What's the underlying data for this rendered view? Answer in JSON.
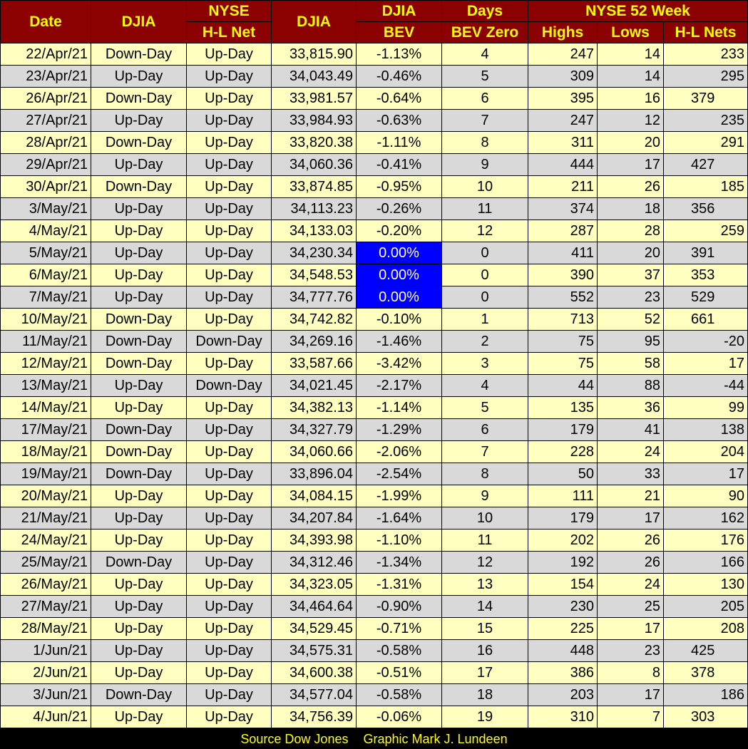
{
  "header": {
    "date": "Date",
    "djia_signal": "DJIA",
    "nyse_hl_line1": "NYSE",
    "nyse_hl_line2": "H-L Net",
    "djia_close": "DJIA",
    "bev_line1": "DJIA",
    "bev_line2": "BEV",
    "days_line1": "Days",
    "days_line2": "BEV Zero",
    "group_52week": "NYSE 52 Week",
    "highs": "Highs",
    "lows": "Lows",
    "hl_nets": "H-L Nets"
  },
  "rows": [
    {
      "date": "22/Apr/21",
      "djia": "Down-Day",
      "nyse": "Up-Day",
      "close": "33,815.90",
      "bev": "-1.13%",
      "days": "4",
      "highs": "247",
      "lows": "14",
      "net": "233",
      "net_align": "r"
    },
    {
      "date": "23/Apr/21",
      "djia": "Up-Day",
      "nyse": "Up-Day",
      "close": "34,043.49",
      "bev": "-0.46%",
      "days": "5",
      "highs": "309",
      "lows": "14",
      "net": "295",
      "net_align": "r"
    },
    {
      "date": "26/Apr/21",
      "djia": "Down-Day",
      "nyse": "Up-Day",
      "close": "33,981.57",
      "bev": "-0.64%",
      "days": "6",
      "highs": "395",
      "lows": "16",
      "net": "379",
      "net_align": "l"
    },
    {
      "date": "27/Apr/21",
      "djia": "Up-Day",
      "nyse": "Up-Day",
      "close": "33,984.93",
      "bev": "-0.63%",
      "days": "7",
      "highs": "247",
      "lows": "12",
      "net": "235",
      "net_align": "r"
    },
    {
      "date": "28/Apr/21",
      "djia": "Down-Day",
      "nyse": "Up-Day",
      "close": "33,820.38",
      "bev": "-1.11%",
      "days": "8",
      "highs": "311",
      "lows": "20",
      "net": "291",
      "net_align": "r"
    },
    {
      "date": "29/Apr/21",
      "djia": "Up-Day",
      "nyse": "Up-Day",
      "close": "34,060.36",
      "bev": "-0.41%",
      "days": "9",
      "highs": "444",
      "lows": "17",
      "net": "427",
      "net_align": "l"
    },
    {
      "date": "30/Apr/21",
      "djia": "Down-Day",
      "nyse": "Up-Day",
      "close": "33,874.85",
      "bev": "-0.95%",
      "days": "10",
      "highs": "211",
      "lows": "26",
      "net": "185",
      "net_align": "r"
    },
    {
      "date": "3/May/21",
      "djia": "Up-Day",
      "nyse": "Up-Day",
      "close": "34,113.23",
      "bev": "-0.26%",
      "days": "11",
      "highs": "374",
      "lows": "18",
      "net": "356",
      "net_align": "l"
    },
    {
      "date": "4/May/21",
      "djia": "Up-Day",
      "nyse": "Up-Day",
      "close": "34,133.03",
      "bev": "-0.20%",
      "days": "12",
      "highs": "287",
      "lows": "28",
      "net": "259",
      "net_align": "r"
    },
    {
      "date": "5/May/21",
      "djia": "Up-Day",
      "nyse": "Up-Day",
      "close": "34,230.34",
      "bev": "0.00%",
      "days": "0",
      "highs": "411",
      "lows": "20",
      "net": "391",
      "net_align": "l",
      "bev_zero": true
    },
    {
      "date": "6/May/21",
      "djia": "Up-Day",
      "nyse": "Up-Day",
      "close": "34,548.53",
      "bev": "0.00%",
      "days": "0",
      "highs": "390",
      "lows": "37",
      "net": "353",
      "net_align": "l",
      "bev_zero": true
    },
    {
      "date": "7/May/21",
      "djia": "Up-Day",
      "nyse": "Up-Day",
      "close": "34,777.76",
      "bev": "0.00%",
      "days": "0",
      "highs": "552",
      "lows": "23",
      "net": "529",
      "net_align": "l",
      "bev_zero": true
    },
    {
      "date": "10/May/21",
      "djia": "Down-Day",
      "nyse": "Up-Day",
      "close": "34,742.82",
      "bev": "-0.10%",
      "days": "1",
      "highs": "713",
      "lows": "52",
      "net": "661",
      "net_align": "l"
    },
    {
      "date": "11/May/21",
      "djia": "Down-Day",
      "nyse": "Down-Day",
      "close": "34,269.16",
      "bev": "-1.46%",
      "days": "2",
      "highs": "75",
      "lows": "95",
      "net": "-20",
      "net_align": "r"
    },
    {
      "date": "12/May/21",
      "djia": "Down-Day",
      "nyse": "Up-Day",
      "close": "33,587.66",
      "bev": "-3.42%",
      "days": "3",
      "highs": "75",
      "lows": "58",
      "net": "17",
      "net_align": "r"
    },
    {
      "date": "13/May/21",
      "djia": "Up-Day",
      "nyse": "Down-Day",
      "close": "34,021.45",
      "bev": "-2.17%",
      "days": "4",
      "highs": "44",
      "lows": "88",
      "net": "-44",
      "net_align": "r"
    },
    {
      "date": "14/May/21",
      "djia": "Up-Day",
      "nyse": "Up-Day",
      "close": "34,382.13",
      "bev": "-1.14%",
      "days": "5",
      "highs": "135",
      "lows": "36",
      "net": "99",
      "net_align": "r"
    },
    {
      "date": "17/May/21",
      "djia": "Down-Day",
      "nyse": "Up-Day",
      "close": "34,327.79",
      "bev": "-1.29%",
      "days": "6",
      "highs": "179",
      "lows": "41",
      "net": "138",
      "net_align": "r"
    },
    {
      "date": "18/May/21",
      "djia": "Down-Day",
      "nyse": "Up-Day",
      "close": "34,060.66",
      "bev": "-2.06%",
      "days": "7",
      "highs": "228",
      "lows": "24",
      "net": "204",
      "net_align": "r"
    },
    {
      "date": "19/May/21",
      "djia": "Down-Day",
      "nyse": "Up-Day",
      "close": "33,896.04",
      "bev": "-2.54%",
      "days": "8",
      "highs": "50",
      "lows": "33",
      "net": "17",
      "net_align": "r"
    },
    {
      "date": "20/May/21",
      "djia": "Up-Day",
      "nyse": "Up-Day",
      "close": "34,084.15",
      "bev": "-1.99%",
      "days": "9",
      "highs": "111",
      "lows": "21",
      "net": "90",
      "net_align": "r"
    },
    {
      "date": "21/May/21",
      "djia": "Up-Day",
      "nyse": "Up-Day",
      "close": "34,207.84",
      "bev": "-1.64%",
      "days": "10",
      "highs": "179",
      "lows": "17",
      "net": "162",
      "net_align": "r"
    },
    {
      "date": "24/May/21",
      "djia": "Up-Day",
      "nyse": "Up-Day",
      "close": "34,393.98",
      "bev": "-1.10%",
      "days": "11",
      "highs": "202",
      "lows": "26",
      "net": "176",
      "net_align": "r"
    },
    {
      "date": "25/May/21",
      "djia": "Down-Day",
      "nyse": "Up-Day",
      "close": "34,312.46",
      "bev": "-1.34%",
      "days": "12",
      "highs": "192",
      "lows": "26",
      "net": "166",
      "net_align": "r"
    },
    {
      "date": "26/May/21",
      "djia": "Up-Day",
      "nyse": "Up-Day",
      "close": "34,323.05",
      "bev": "-1.31%",
      "days": "13",
      "highs": "154",
      "lows": "24",
      "net": "130",
      "net_align": "r"
    },
    {
      "date": "27/May/21",
      "djia": "Up-Day",
      "nyse": "Up-Day",
      "close": "34,464.64",
      "bev": "-0.90%",
      "days": "14",
      "highs": "230",
      "lows": "25",
      "net": "205",
      "net_align": "r"
    },
    {
      "date": "28/May/21",
      "djia": "Up-Day",
      "nyse": "Up-Day",
      "close": "34,529.45",
      "bev": "-0.71%",
      "days": "15",
      "highs": "225",
      "lows": "17",
      "net": "208",
      "net_align": "r"
    },
    {
      "date": "1/Jun/21",
      "djia": "Up-Day",
      "nyse": "Up-Day",
      "close": "34,575.31",
      "bev": "-0.58%",
      "days": "16",
      "highs": "448",
      "lows": "23",
      "net": "425",
      "net_align": "l"
    },
    {
      "date": "2/Jun/21",
      "djia": "Up-Day",
      "nyse": "Up-Day",
      "close": "34,600.38",
      "bev": "-0.51%",
      "days": "17",
      "highs": "386",
      "lows": "8",
      "net": "378",
      "net_align": "l"
    },
    {
      "date": "3/Jun/21",
      "djia": "Down-Day",
      "nyse": "Up-Day",
      "close": "34,577.04",
      "bev": "-0.58%",
      "days": "18",
      "highs": "203",
      "lows": "17",
      "net": "186",
      "net_align": "r"
    },
    {
      "date": "4/Jun/21",
      "djia": "Up-Day",
      "nyse": "Up-Day",
      "close": "34,756.39",
      "bev": "-0.06%",
      "days": "19",
      "highs": "310",
      "lows": "7",
      "net": "303",
      "net_align": "l"
    }
  ],
  "footer": {
    "source": "Source Dow Jones",
    "credit": "Graphic Mark J. Lundeen"
  },
  "colors": {
    "header_bg": "#8b0000",
    "header_text": "#ffff00",
    "row_odd": "#ffffc0",
    "row_even": "#d9d9d9",
    "bev_zero_highlight": "#0000ff"
  }
}
